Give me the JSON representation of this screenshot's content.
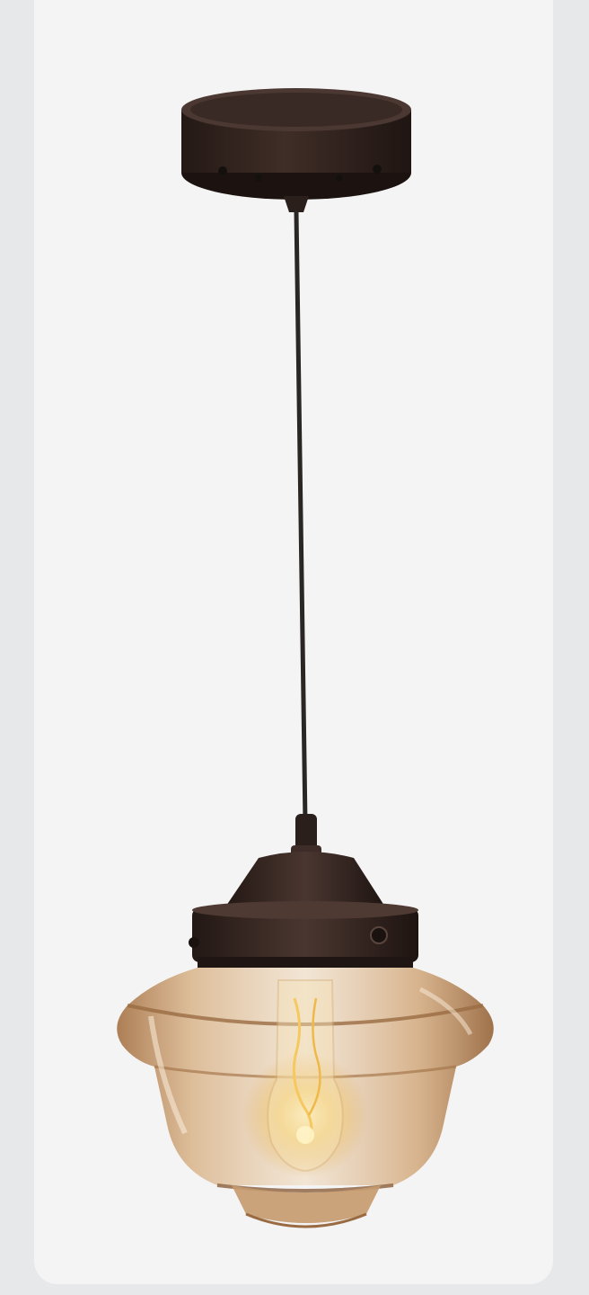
{
  "image": {
    "subject": "pendant-light",
    "background_color": "#f4f4f5",
    "frame_color": "#e7e8ea"
  },
  "colors": {
    "metal_dark": "#2b1f1c",
    "metal_mid": "#3d2c27",
    "metal_highlight": "#5a453e",
    "cord": "#2a2624",
    "glass_amber": "#c79a6a",
    "glass_amber_light": "#e8c9a2",
    "filament_glow": "#f5d27a"
  }
}
